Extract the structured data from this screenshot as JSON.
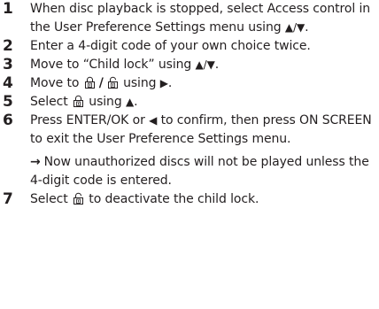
{
  "steps": [
    {
      "num": "1",
      "text_a": "When disc playback is stopped, select Access control in the User Preference Settings menu using ",
      "glyph": "▲/▼",
      "text_b": "."
    },
    {
      "num": "2",
      "text": "Enter a 4-digit code of your own choice twice."
    },
    {
      "num": "3",
      "text_a": "Move to “Child lock” using ",
      "glyph": "▲/▼",
      "text_b": "."
    },
    {
      "num": "4",
      "text_a": "Move to ",
      "slash": "/",
      "text_b": " using ",
      "glyph": "▶",
      "text_c": "."
    },
    {
      "num": "5",
      "text_a": "Select ",
      "text_b": " using ",
      "glyph": "▲",
      "text_c": "."
    },
    {
      "num": "6",
      "text_a": "Press ENTER/OK or ",
      "glyph": "◀",
      "text_b": " to confirm, then press ON SCREEN to exit the User Preference Settings menu.",
      "result_arrow": "→",
      "result_text": "Now unauthorized discs will not be played unless the 4-digit code is entered."
    },
    {
      "num": "7",
      "text_a": "Select ",
      "text_b": " to deactivate the child lock."
    }
  ],
  "icons": {
    "locked": "padlock-closed-icon",
    "unlocked": "padlock-open-icon"
  },
  "colors": {
    "text": "#231f20"
  }
}
